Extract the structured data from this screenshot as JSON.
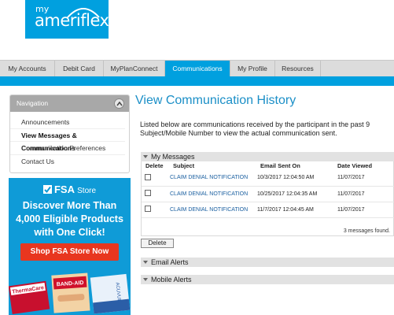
{
  "logo": {
    "line1": "my",
    "line2": "ameriflex"
  },
  "nav": {
    "tabs": [
      {
        "label": "My Accounts"
      },
      {
        "label": "Debit Card"
      },
      {
        "label": "MyPlanConnect"
      },
      {
        "label": "Communications",
        "active": true
      },
      {
        "label": "My Profile"
      },
      {
        "label": "Resources"
      }
    ]
  },
  "sidebar": {
    "header": "Navigation",
    "items": [
      {
        "label": "Announcements"
      },
      {
        "label": "View Messages & Communications",
        "active": true
      },
      {
        "label": "Communication Preferences"
      },
      {
        "label": "Contact Us"
      }
    ]
  },
  "ad": {
    "brand": "FSA",
    "brand_suffix": "Store",
    "headline": "Discover More Than 4,000 Eligible Products with One Click!",
    "button": "Shop FSA Store Now",
    "products": [
      "ThermaCare",
      "BAND-AID",
      "ACUVUE"
    ]
  },
  "main": {
    "title": "View Communication History",
    "intro_line1": "Listed below are communications received by the participant in the past 9",
    "intro_line2": "Subject/Mobile Number to view the actual communication sent."
  },
  "messages": {
    "section_label": "My Messages",
    "columns": {
      "delete": "Delete",
      "subject": "Subject",
      "sent": "Email Sent On",
      "viewed": "Date Viewed"
    },
    "rows": [
      {
        "subject": "CLAIM DENIAL NOTIFICATION",
        "sent": "10/3/2017 12:04:50 AM",
        "viewed": "11/07/2017"
      },
      {
        "subject": "CLAIM DENIAL NOTIFICATION",
        "sent": "10/25/2017 12:04:35 AM",
        "viewed": "11/07/2017"
      },
      {
        "subject": "CLAIM DENIAL NOTIFICATION",
        "sent": "11/7/2017 12:04:45 AM",
        "viewed": "11/07/2017"
      }
    ],
    "count": "3 messages found.",
    "delete_button": "Delete"
  },
  "email_alerts": {
    "label": "Email Alerts"
  },
  "mobile_alerts": {
    "label": "Mobile Alerts"
  },
  "colors": {
    "brand_blue": "#00a0df",
    "title_blue": "#1b8fc7",
    "cta_red": "#e8361f"
  }
}
